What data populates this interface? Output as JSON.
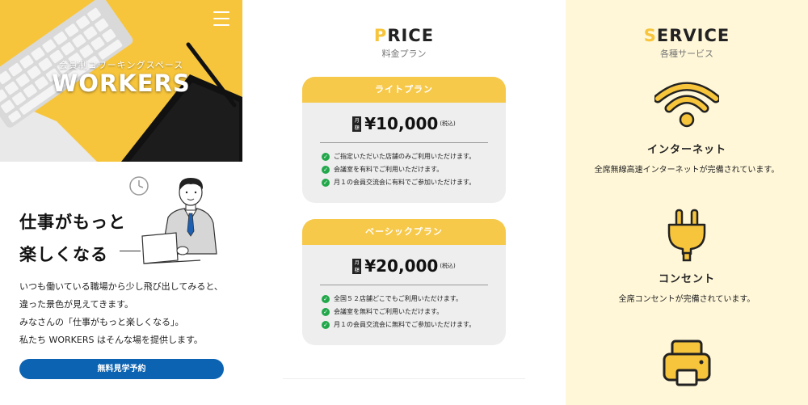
{
  "colors": {
    "accent": "#f7c53b",
    "card_header": "#f7c94a",
    "card_bg": "#eeeeee",
    "cta": "#0b63b2",
    "check": "#21a84a",
    "service_bg": "#fff7d8"
  },
  "hero": {
    "subtitle": "会員制コワーキングスペース",
    "title": "WORKERS",
    "menu_icon": "hamburger-icon"
  },
  "intro": {
    "headline_1": "仕事がもっと",
    "headline_2": "楽しくなる",
    "paragraph_lines": [
      "いつも働いている職場から少し飛び出してみると、",
      "違った景色が見えてきます。",
      "みなさんの「仕事がもっと楽しくなる」。",
      "私たち WORKERS はそんな場を提供します。"
    ],
    "cta_label": "無料見学予約",
    "illustration_icon": "businessman-laptop-icon"
  },
  "price": {
    "title_first": "P",
    "title_rest": "RICE",
    "subtitle": "料金プラン",
    "plans": [
      {
        "name": "ライトプラン",
        "tag": "月額",
        "price": "¥10,000",
        "tax": "(税込)",
        "features": [
          "ご指定いただいた店舗のみご利用いただけます。",
          "会議室を有料でご利用いただけます。",
          "月１の会員交流会に有料でご参加いただけます。"
        ]
      },
      {
        "name": "ベーシックプラン",
        "tag": "月額",
        "price": "¥20,000",
        "tax": "(税込)",
        "features": [
          "全国５２店舗どこでもご利用いただけます。",
          "会議室を無料でご利用いただけます。",
          "月１の会員交流会に無料でご参加いただけます。"
        ]
      }
    ]
  },
  "service": {
    "title_first": "S",
    "title_rest": "ERVICE",
    "subtitle": "各種サービス",
    "items": [
      {
        "name": "インターネット",
        "desc": "全席無線高速インターネットが完備されています。",
        "icon": "wifi-icon"
      },
      {
        "name": "コンセント",
        "desc": "全席コンセントが完備されています。",
        "icon": "plug-icon"
      },
      {
        "name": "",
        "desc": "",
        "icon": "printer-icon"
      }
    ]
  }
}
